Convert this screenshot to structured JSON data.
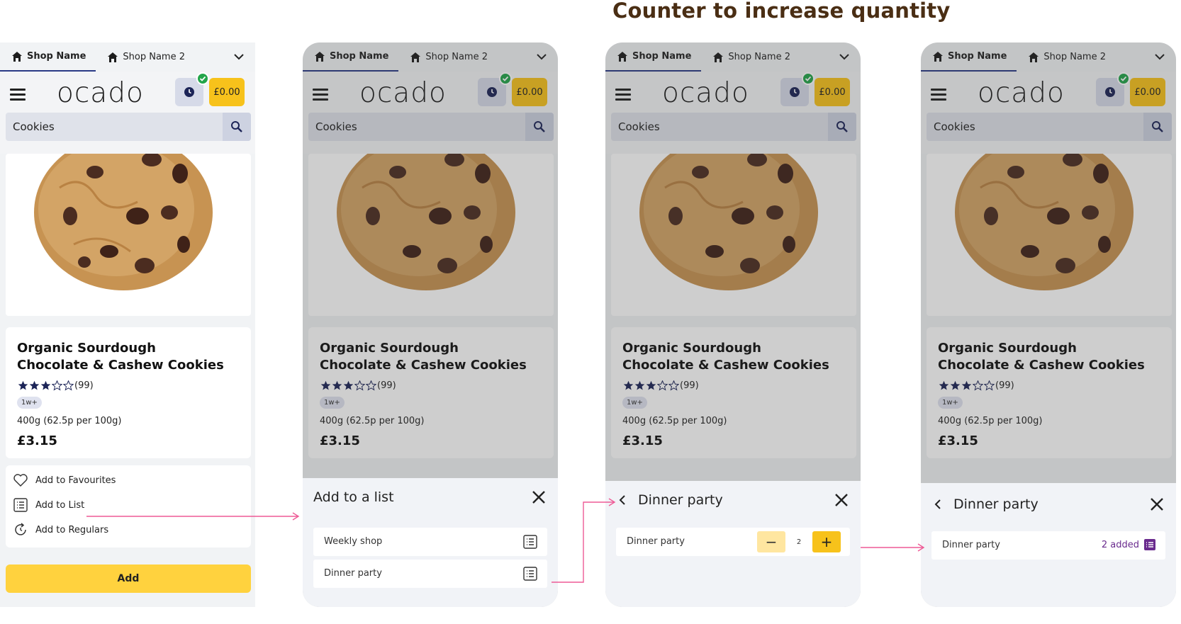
{
  "headline": "Counter to increase quantity",
  "app": {
    "tabs": [
      "Shop Name",
      "Shop Name 2"
    ],
    "logo": "ocado",
    "basket_total": "£0.00",
    "search_value": "Cookies"
  },
  "product": {
    "title": "Organic Sourdough Chocolate & Cashew Cookies",
    "rating": 3,
    "rating_count": "(99)",
    "badge": "1w+",
    "weight": "400g  (62.5p per 100g)",
    "price": "£3.15"
  },
  "actions": [
    "Add to Favourites",
    "Add to List",
    "Add to Regulars"
  ],
  "add_button": "Add",
  "sheet_add": {
    "title": "Add to a list",
    "lists": [
      "Weekly shop",
      "Dinner party"
    ]
  },
  "sheet_counter": {
    "title": "Dinner party",
    "row_label": "Dinner party",
    "quantity": "2"
  },
  "sheet_added": {
    "title": "Dinner party",
    "row_label": "Dinner party",
    "status": "2 added"
  },
  "colors": {
    "accent": "#f7c21b",
    "arrow": "#ee5a96",
    "added": "#6a2b8e"
  }
}
